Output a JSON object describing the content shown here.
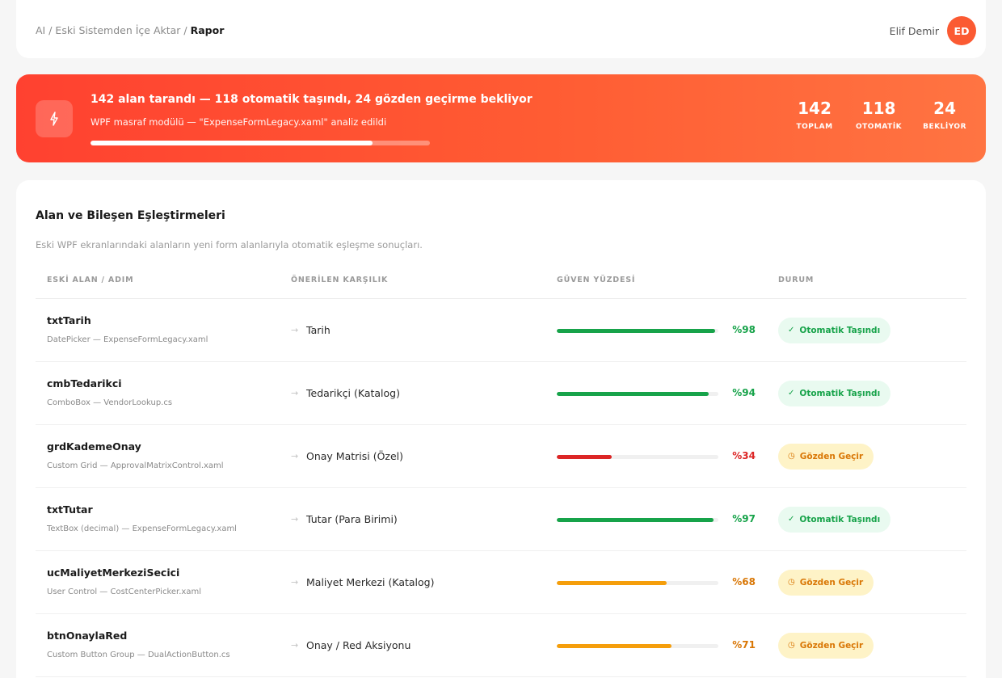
{
  "colors": {
    "accent": "#fb5a32",
    "success": "#17a34a",
    "danger": "#dc2626",
    "warning": "#f59e0b",
    "success_bg": "#e9faf0",
    "warning_bg": "#fef3c7",
    "warning_text": "#d97706"
  },
  "header": {
    "breadcrumb": [
      "AI",
      "Eski Sistemden İçe Aktar"
    ],
    "breadcrumb_separator": " / ",
    "breadcrumb_current": "Rapor",
    "user_name": "Elif Demir",
    "user_initials": "ED"
  },
  "summary": {
    "icon": "lightning-icon",
    "title": "142 alan tarandı — 118 otomatik taşındı, 24 gözden geçirme bekliyor",
    "subtitle": "WPF masraf modülü — \"ExpenseFormLegacy.xaml\" analiz edildi",
    "progress_fraction": 0.83,
    "stats": [
      {
        "value": "142",
        "label": "TOPLAM"
      },
      {
        "value": "118",
        "label": "OTOMATİK"
      },
      {
        "value": "24",
        "label": "BEKLİYOR"
      }
    ]
  },
  "mappings": {
    "title": "Alan ve Bileşen Eşleştirmeleri",
    "description": "Eski WPF ekranlarındaki alanların yeni form alanlarıyla otomatik eşleşme sonuçları.",
    "columns": [
      "ESKİ ALAN / ADIM",
      "ÖNERİLEN KARŞILIK",
      "GÜVEN YÜZDESİ",
      "DURUM"
    ],
    "rows": [
      {
        "name": "txtTarih",
        "source": "DatePicker — ExpenseFormLegacy.xaml",
        "match": "Tarih",
        "confidence": 98,
        "confidence_label": "%98",
        "level": "high",
        "status": "Otomatik Taşındı",
        "status_type": "auto",
        "status_icon": "check-icon"
      },
      {
        "name": "cmbTedarikci",
        "source": "ComboBox — VendorLookup.cs",
        "match": "Tedarikçi (Katalog)",
        "confidence": 94,
        "confidence_label": "%94",
        "level": "high",
        "status": "Otomatik Taşındı",
        "status_type": "auto",
        "status_icon": "check-icon"
      },
      {
        "name": "grdKademeOnay",
        "source": "Custom Grid — ApprovalMatrixControl.xaml",
        "match": "Onay Matrisi (Özel)",
        "confidence": 34,
        "confidence_label": "%34",
        "level": "low",
        "status": "Gözden Geçir",
        "status_type": "review",
        "status_icon": "clock-icon"
      },
      {
        "name": "txtTutar",
        "source": "TextBox (decimal) — ExpenseFormLegacy.xaml",
        "match": "Tutar (Para Birimi)",
        "confidence": 97,
        "confidence_label": "%97",
        "level": "high",
        "status": "Otomatik Taşındı",
        "status_type": "auto",
        "status_icon": "check-icon"
      },
      {
        "name": "ucMaliyetMerkeziSecici",
        "source": "User Control — CostCenterPicker.xaml",
        "match": "Maliyet Merkezi (Katalog)",
        "confidence": 68,
        "confidence_label": "%68",
        "level": "medium",
        "status": "Gözden Geçir",
        "status_type": "review",
        "status_icon": "clock-icon"
      },
      {
        "name": "btnOnaylaRed",
        "source": "Custom Button Group — DualActionButton.cs",
        "match": "Onay / Red Aksiyonu",
        "confidence": 71,
        "confidence_label": "%71",
        "level": "medium",
        "status": "Gözden Geçir",
        "status_type": "review",
        "status_icon": "clock-icon"
      }
    ]
  }
}
